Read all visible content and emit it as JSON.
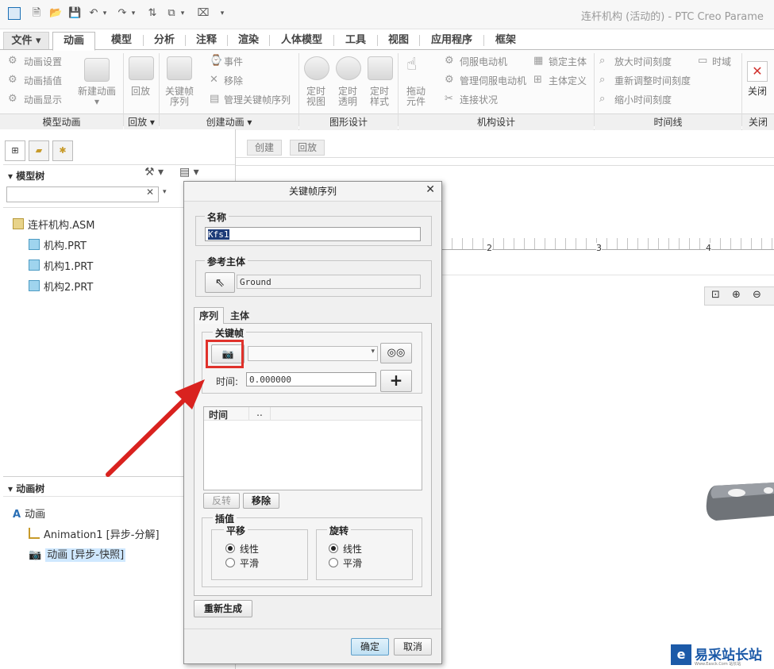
{
  "app": {
    "title": "连杆机构 (活动的) - PTC Creo Parame",
    "quick_access_icons": [
      "app-logo-icon",
      "new-file-icon",
      "open-folder-icon",
      "save-icon",
      "undo-icon",
      "redo-icon",
      "regenerate-icon",
      "window-icon",
      "close-window-icon",
      "customize-icon"
    ]
  },
  "tabs": [
    "文件",
    "动画",
    "模型",
    "分析",
    "注释",
    "渲染",
    "人体模型",
    "工具",
    "视图",
    "应用程序",
    "框架"
  ],
  "ribbon": {
    "model_anim": {
      "items": [
        "动画设置",
        "动画插值",
        "动画显示"
      ],
      "new_anim": "新建动画",
      "label": "模型动画"
    },
    "playback": {
      "item": "回放",
      "label": "回放"
    },
    "create_anim": {
      "keyframe_line1": "关键帧",
      "keyframe_line2": "序列",
      "event": "事件",
      "remove": "移除",
      "manage": "管理关键帧序列",
      "label": "创建动画"
    },
    "graphic_design": {
      "items": [
        [
          "定时",
          "视图"
        ],
        [
          "定时",
          "透明"
        ],
        [
          "定时",
          "样式"
        ]
      ],
      "label": "图形设计"
    },
    "mechanism": {
      "drag_line1": "拖动",
      "drag_line2": "元件",
      "servo": "伺服电动机",
      "manage_servo": "管理伺服电动机",
      "connection": "连接状况",
      "lock": "锁定主体",
      "body_def": "主体定义",
      "label": "机构设计"
    },
    "timeline": {
      "zoom_in": "放大时间刻度",
      "readjust": "重新调整时间刻度",
      "zoom_out": "缩小时间刻度",
      "timedomain": "时域",
      "label": "时间线"
    },
    "close": {
      "item": "关闭",
      "label": "关闭"
    }
  },
  "left": {
    "model_tree_title": "模型树",
    "model_items": [
      "连杆机构.ASM",
      "机构.PRT",
      "机构1.PRT",
      "机构2.PRT"
    ],
    "anim_tree_title": "动画树",
    "anim_items": [
      "动画",
      "Animation1 [异步-分解]",
      "动画 [异步-快照]"
    ]
  },
  "timeline_strip": {
    "create": "创建",
    "playback": "回放",
    "ticks": [
      "2",
      "3",
      "4"
    ]
  },
  "dialog": {
    "title": "关键帧序列",
    "name_label": "名称",
    "name_value": "Kfs1",
    "ref_label": "参考主体",
    "ref_value": "Ground",
    "tabs": [
      "序列",
      "主体"
    ],
    "keyframe_label": "关键帧",
    "time_label": "时间",
    "time_value": "0.000000",
    "table_cols": [
      "时间",
      ".."
    ],
    "reverse": "反转",
    "remove": "移除",
    "interp_label": "插值",
    "translate_label": "平移",
    "rotate_label": "旋转",
    "linear": "线性",
    "smooth": "平滑",
    "regen": "重新生成",
    "ok": "确定",
    "cancel": "取消"
  },
  "watermark": {
    "text": "易采站长站",
    "sub": "Www.Easck.Com 站长站"
  },
  "colors": {
    "highlight_box": "#e0322b",
    "arrow": "#d9221f",
    "selected_bg": "#cfe8ff",
    "ok_btn": "#cde7f7"
  }
}
